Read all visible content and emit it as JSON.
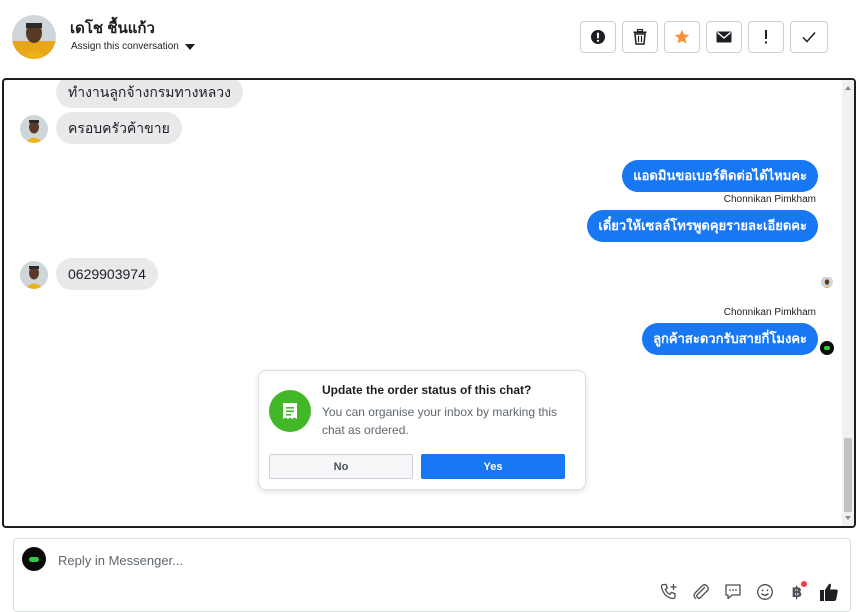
{
  "header": {
    "contact_name": "เดโช ชื้นแก้ว",
    "assign_label": "Assign this conversation",
    "toolbar": [
      {
        "name": "mark-spam-button",
        "icon": "exclamation-circle-icon"
      },
      {
        "name": "delete-button",
        "icon": "trash-icon"
      },
      {
        "name": "star-button",
        "icon": "star-icon"
      },
      {
        "name": "mark-unread-button",
        "icon": "envelope-icon"
      },
      {
        "name": "follow-up-button",
        "icon": "exclamation-icon"
      },
      {
        "name": "mark-done-button",
        "icon": "check-icon"
      }
    ]
  },
  "messages": [
    {
      "direction": "incoming",
      "text": "ทำงานลูกจ้างกรมทางหลวง"
    },
    {
      "direction": "incoming",
      "text": "ครอบครัวค้าขาย"
    },
    {
      "direction": "outgoing",
      "text": "แอดมินขอเบอร์ติดต่อได้ไหมคะ"
    },
    {
      "direction": "outgoing",
      "sender": "Chonnikan Pimkham",
      "text": "เดี๋ยวให้เซลล์โทรพูดคุยรายละเอียดคะ"
    },
    {
      "direction": "incoming",
      "text": "0629903974"
    },
    {
      "direction": "outgoing",
      "sender": "Chonnikan Pimkham",
      "text": "ลูกค้าสะดวกรับสายกี่โมงคะ"
    }
  ],
  "prompt": {
    "title": "Update the order status of this chat?",
    "text": "You can organise your inbox by marking this chat as ordered.",
    "no_label": "No",
    "yes_label": "Yes"
  },
  "composer": {
    "placeholder": "Reply in Messenger...",
    "tools": [
      "phone-plus-icon",
      "paperclip-icon",
      "chat-bubble-icon",
      "smiley-icon",
      "baht-icon",
      "thumbs-up-icon"
    ],
    "baht_symbol": "฿"
  },
  "colors": {
    "accent": "#1877f2",
    "incoming_bubble": "#e9e9eb",
    "star": "#f7923b",
    "prompt_icon": "#42b72a",
    "notification_dot": "#fa383e"
  }
}
